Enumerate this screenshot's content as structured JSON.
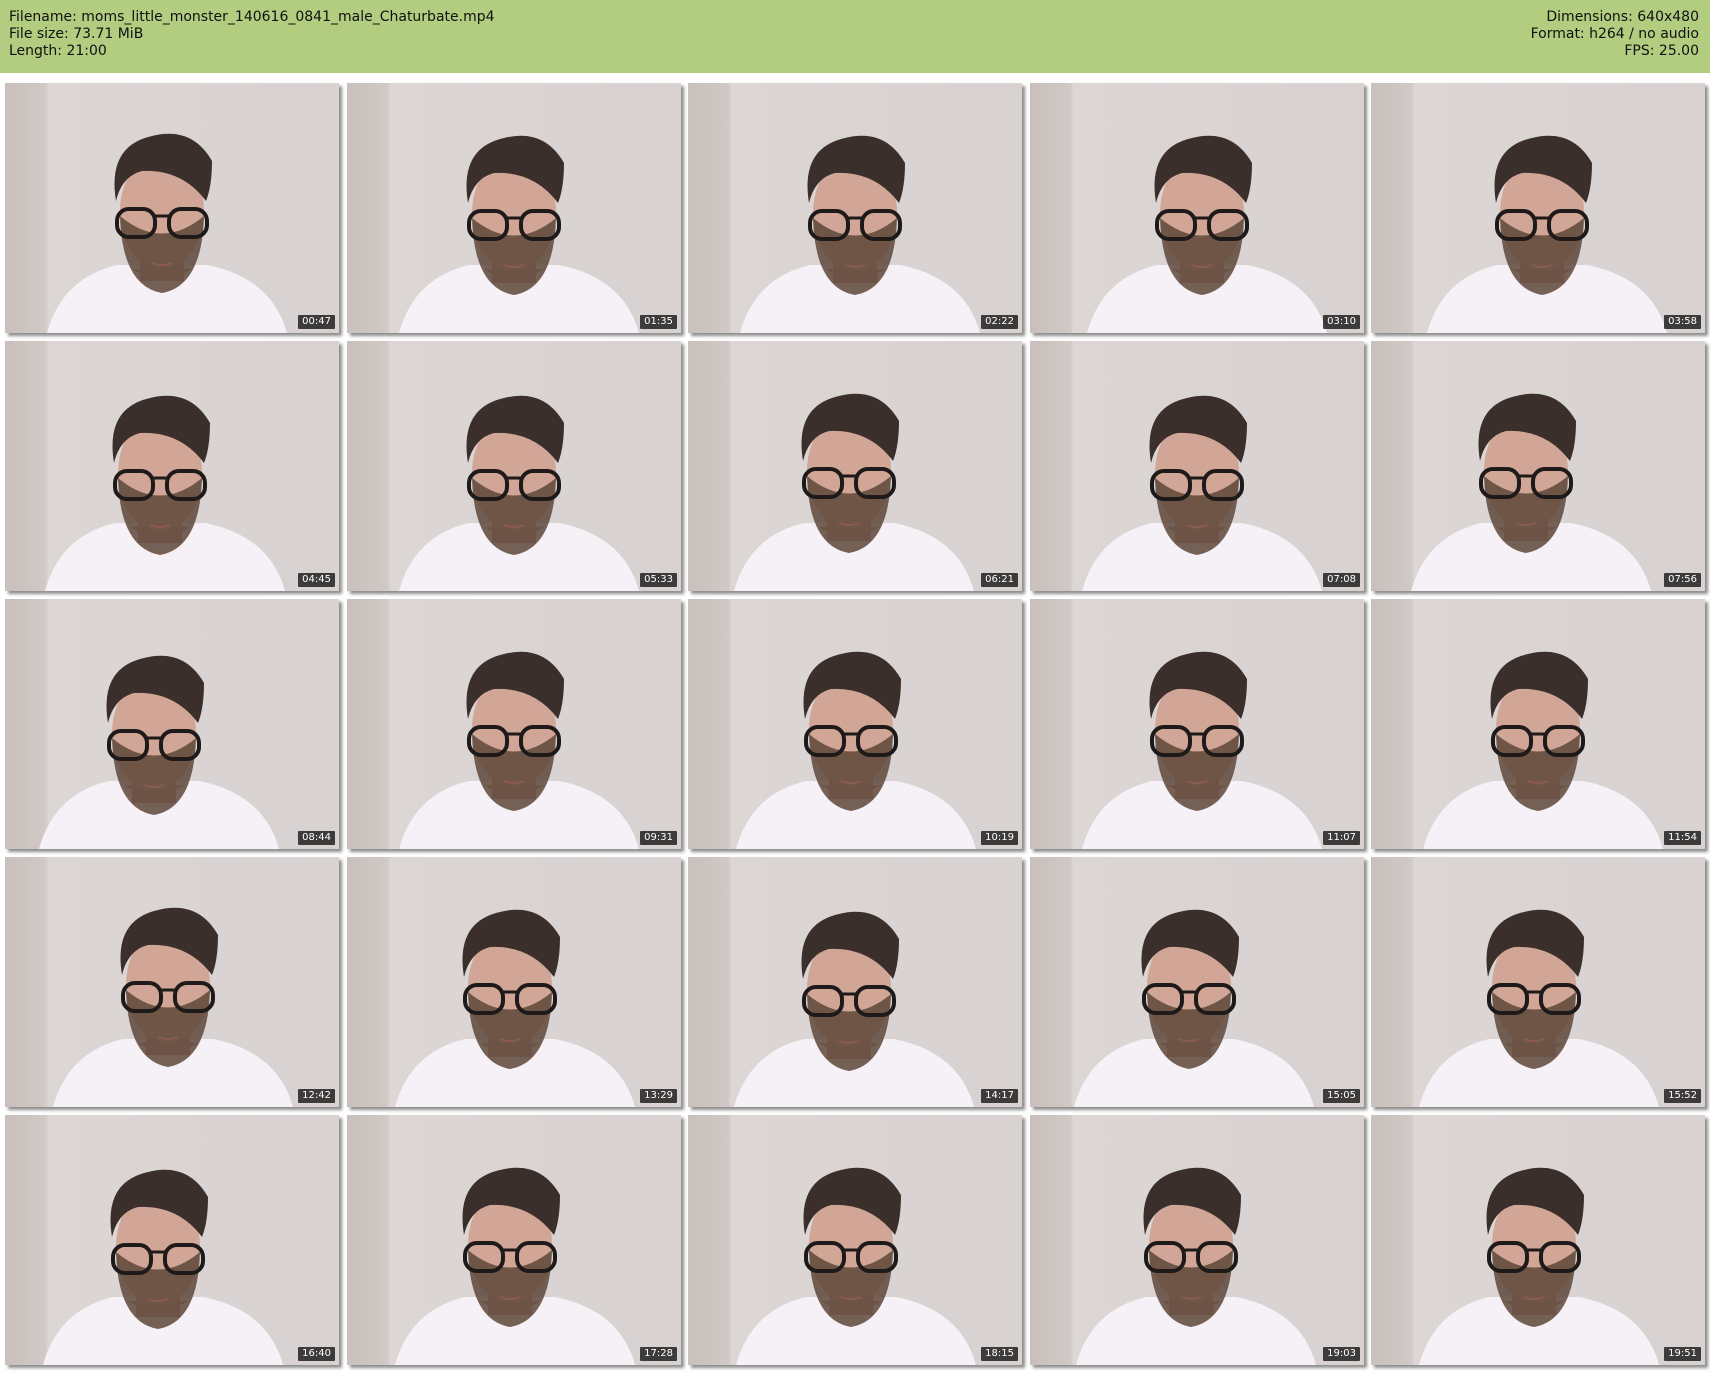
{
  "header": {
    "filename": "Filename: moms_little_monster_140616_0841_male_Chaturbate.mp4",
    "filesize": "File size: 73.71 MiB",
    "length": "Length: 21:00",
    "dimensions": "Dimensions: 640x480",
    "format": "Format: h264 / no audio",
    "fps": "FPS: 25.00"
  },
  "colors": {
    "header_bg": "#b2cc80",
    "timestamp_bg": "#000000"
  },
  "thumbnails": [
    {
      "timestamp": "00:47"
    },
    {
      "timestamp": "01:35"
    },
    {
      "timestamp": "02:22"
    },
    {
      "timestamp": "03:10"
    },
    {
      "timestamp": "03:58"
    },
    {
      "timestamp": "04:45"
    },
    {
      "timestamp": "05:33"
    },
    {
      "timestamp": "06:21"
    },
    {
      "timestamp": "07:08"
    },
    {
      "timestamp": "07:56"
    },
    {
      "timestamp": "08:44"
    },
    {
      "timestamp": "09:31"
    },
    {
      "timestamp": "10:19"
    },
    {
      "timestamp": "11:07"
    },
    {
      "timestamp": "11:54"
    },
    {
      "timestamp": "12:42"
    },
    {
      "timestamp": "13:29"
    },
    {
      "timestamp": "14:17"
    },
    {
      "timestamp": "15:05"
    },
    {
      "timestamp": "15:52"
    },
    {
      "timestamp": "16:40"
    },
    {
      "timestamp": "17:28"
    },
    {
      "timestamp": "18:15"
    },
    {
      "timestamp": "19:03"
    },
    {
      "timestamp": "19:51"
    }
  ]
}
